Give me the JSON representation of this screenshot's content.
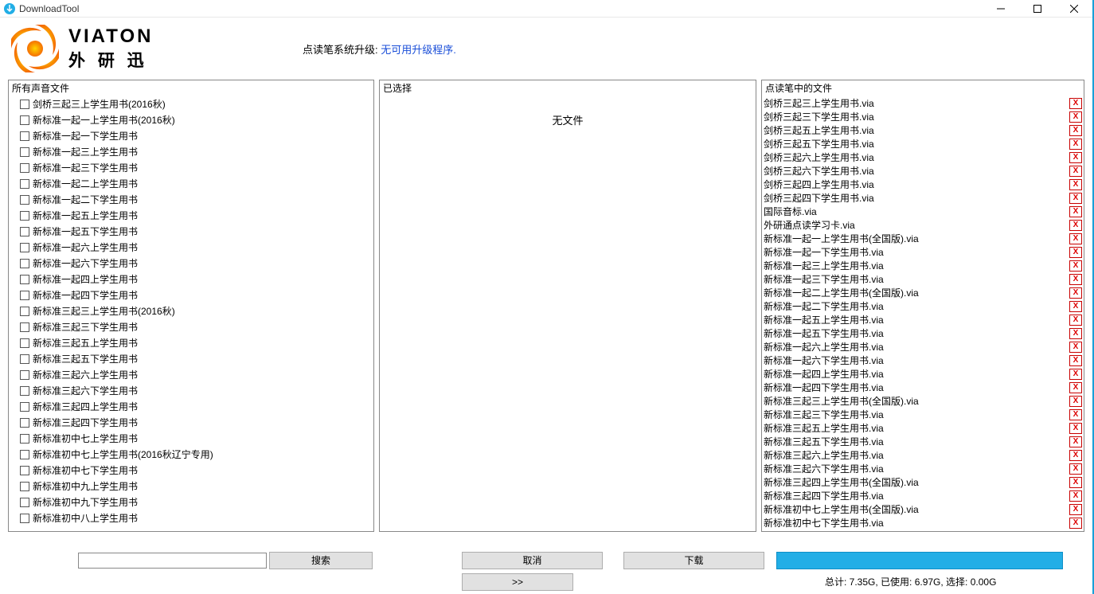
{
  "title": "DownloadTool",
  "upgrade_label": "点读笔系统升级: ",
  "upgrade_value": "无可用升级程序.",
  "panels": {
    "left_header": "所有声音文件",
    "mid_header": "已选择",
    "empty_text": "无文件",
    "right_header": "点读笔中的文件"
  },
  "checklist": [
    "剑桥三起三上学生用书(2016秋)",
    "新标准一起一上学生用书(2016秋)",
    "新标准一起一下学生用书",
    "新标准一起三上学生用书",
    "新标准一起三下学生用书",
    "新标准一起二上学生用书",
    "新标准一起二下学生用书",
    "新标准一起五上学生用书",
    "新标准一起五下学生用书",
    "新标准一起六上学生用书",
    "新标准一起六下学生用书",
    "新标准一起四上学生用书",
    "新标准一起四下学生用书",
    "新标准三起三上学生用书(2016秋)",
    "新标准三起三下学生用书",
    "新标准三起五上学生用书",
    "新标准三起五下学生用书",
    "新标准三起六上学生用书",
    "新标准三起六下学生用书",
    "新标准三起四上学生用书",
    "新标准三起四下学生用书",
    "新标准初中七上学生用书",
    "新标准初中七上学生用书(2016秋辽宁专用)",
    "新标准初中七下学生用书",
    "新标准初中九上学生用书",
    "新标准初中九下学生用书",
    "新标准初中八上学生用书"
  ],
  "penfiles": [
    "剑桥三起三上学生用书.via",
    "剑桥三起三下学生用书.via",
    "剑桥三起五上学生用书.via",
    "剑桥三起五下学生用书.via",
    "剑桥三起六上学生用书.via",
    "剑桥三起六下学生用书.via",
    "剑桥三起四上学生用书.via",
    "剑桥三起四下学生用书.via",
    "国际音标.via",
    "外研通点读学习卡.via",
    "新标准一起一上学生用书(全国版).via",
    "新标准一起一下学生用书.via",
    "新标准一起三上学生用书.via",
    "新标准一起三下学生用书.via",
    "新标准一起二上学生用书(全国版).via",
    "新标准一起二下学生用书.via",
    "新标准一起五上学生用书.via",
    "新标准一起五下学生用书.via",
    "新标准一起六上学生用书.via",
    "新标准一起六下学生用书.via",
    "新标准一起四上学生用书.via",
    "新标准一起四下学生用书.via",
    "新标准三起三上学生用书(全国版).via",
    "新标准三起三下学生用书.via",
    "新标准三起五上学生用书.via",
    "新标准三起五下学生用书.via",
    "新标准三起六上学生用书.via",
    "新标准三起六下学生用书.via",
    "新标准三起四上学生用书(全国版).via",
    "新标准三起四下学生用书.via",
    "新标准初中七上学生用书(全国版).via",
    "新标准初中七下学生用书.via"
  ],
  "buttons": {
    "search": "搜索",
    "cancel": "取消",
    "download": "下载",
    "arrow": ">>"
  },
  "status": "总计: 7.35G,  已使用: 6.97G,  选择: 0.00G",
  "logo": {
    "line1": "VIATON",
    "line2": "外   研   迅"
  },
  "deleteX": "X"
}
